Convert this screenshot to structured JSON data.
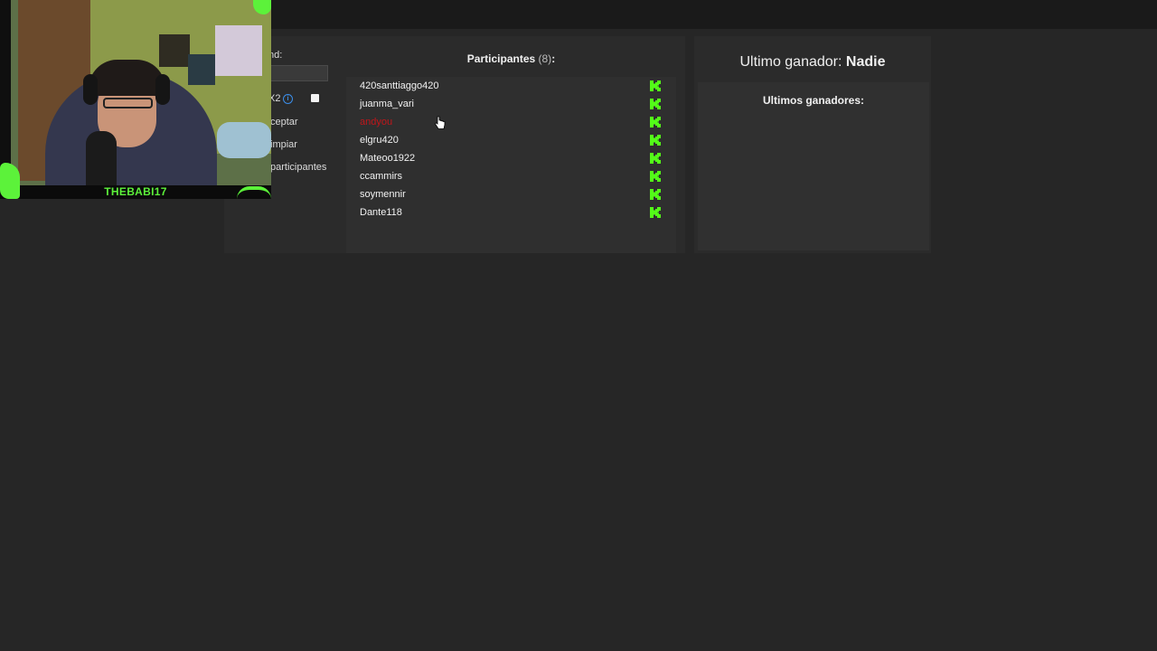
{
  "left_panel": {
    "label_partial": "nd:",
    "input_value": "",
    "multiplier_partial": "X2",
    "buttons": {
      "accept": "ceptar",
      "clear": "impiar",
      "participants": "participantes"
    }
  },
  "participants": {
    "title": "Participantes",
    "count": "(8)",
    "colon": ":",
    "list": [
      {
        "name": "420santtiaggo420",
        "winner": false
      },
      {
        "name": "juanma_vari",
        "winner": false
      },
      {
        "name": "andyou",
        "winner": true
      },
      {
        "name": "elgru420",
        "winner": false
      },
      {
        "name": "Mateoo1922",
        "winner": false
      },
      {
        "name": "ccammirs",
        "winner": false
      },
      {
        "name": "soymennir",
        "winner": false
      },
      {
        "name": "Dante118",
        "winner": false
      }
    ]
  },
  "winner_panel": {
    "last_winner_label": "Ultimo ganador:",
    "last_winner_value": "Nadie",
    "recent_winners_title": "Ultimos ganadores:"
  },
  "webcam": {
    "streamer_name": "THEBABI17"
  },
  "colors": {
    "background": "#262626",
    "panel": "#2b2b2b",
    "kick_green": "#53fc18",
    "winner_red": "#c0161b"
  }
}
